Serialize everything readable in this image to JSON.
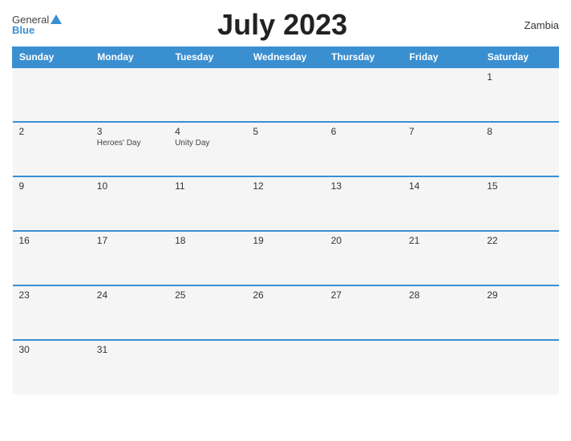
{
  "header": {
    "title": "July 2023",
    "country": "Zambia",
    "logo_general": "General",
    "logo_blue": "Blue"
  },
  "days_of_week": [
    "Sunday",
    "Monday",
    "Tuesday",
    "Wednesday",
    "Thursday",
    "Friday",
    "Saturday"
  ],
  "weeks": [
    [
      {
        "day": "",
        "event": ""
      },
      {
        "day": "",
        "event": ""
      },
      {
        "day": "",
        "event": ""
      },
      {
        "day": "",
        "event": ""
      },
      {
        "day": "",
        "event": ""
      },
      {
        "day": "",
        "event": ""
      },
      {
        "day": "1",
        "event": ""
      }
    ],
    [
      {
        "day": "2",
        "event": ""
      },
      {
        "day": "3",
        "event": "Heroes' Day"
      },
      {
        "day": "4",
        "event": "Unity Day"
      },
      {
        "day": "5",
        "event": ""
      },
      {
        "day": "6",
        "event": ""
      },
      {
        "day": "7",
        "event": ""
      },
      {
        "day": "8",
        "event": ""
      }
    ],
    [
      {
        "day": "9",
        "event": ""
      },
      {
        "day": "10",
        "event": ""
      },
      {
        "day": "11",
        "event": ""
      },
      {
        "day": "12",
        "event": ""
      },
      {
        "day": "13",
        "event": ""
      },
      {
        "day": "14",
        "event": ""
      },
      {
        "day": "15",
        "event": ""
      }
    ],
    [
      {
        "day": "16",
        "event": ""
      },
      {
        "day": "17",
        "event": ""
      },
      {
        "day": "18",
        "event": ""
      },
      {
        "day": "19",
        "event": ""
      },
      {
        "day": "20",
        "event": ""
      },
      {
        "day": "21",
        "event": ""
      },
      {
        "day": "22",
        "event": ""
      }
    ],
    [
      {
        "day": "23",
        "event": ""
      },
      {
        "day": "24",
        "event": ""
      },
      {
        "day": "25",
        "event": ""
      },
      {
        "day": "26",
        "event": ""
      },
      {
        "day": "27",
        "event": ""
      },
      {
        "day": "28",
        "event": ""
      },
      {
        "day": "29",
        "event": ""
      }
    ],
    [
      {
        "day": "30",
        "event": ""
      },
      {
        "day": "31",
        "event": ""
      },
      {
        "day": "",
        "event": ""
      },
      {
        "day": "",
        "event": ""
      },
      {
        "day": "",
        "event": ""
      },
      {
        "day": "",
        "event": ""
      },
      {
        "day": "",
        "event": ""
      }
    ]
  ],
  "colors": {
    "header_bg": "#3a8fd1",
    "cell_bg": "#f5f5f5",
    "border": "#3a8fd1",
    "logo_blue": "#3a8fd1"
  }
}
